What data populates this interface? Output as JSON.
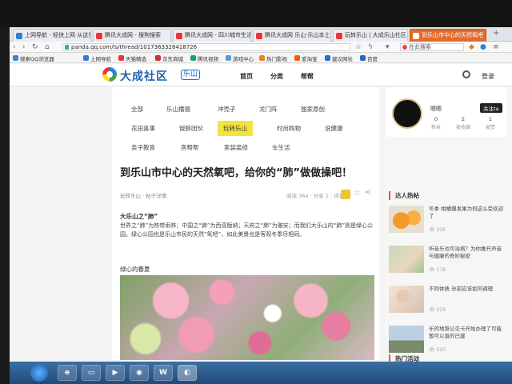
{
  "browser": {
    "tabs": [
      {
        "label": "上网导航 - 轻快上网 从这里"
      },
      {
        "label": "腾讯大成网 - 搜狗搜索"
      },
      {
        "label": "腾讯大成网 - 四川城市生活"
      },
      {
        "label": "腾讯大成网 乐山·乐山本土"
      },
      {
        "label": "玩转乐山 | 大成乐山社区"
      },
      {
        "label": "到乐山市中心的天然氧吧"
      }
    ],
    "url": "panda.qq.com/ls/thread/1017363328418726",
    "search_placeholder": "在此搜索",
    "bookmarks": [
      {
        "label": "搜索QQ浏览器",
        "color": "#3a86d6"
      },
      {
        "label": "上网导航",
        "color": "#2f7fd8"
      },
      {
        "label": "天猫精选",
        "color": "#e23b3b"
      },
      {
        "label": "京东商城",
        "color": "#d32f2f"
      },
      {
        "label": "腾讯视频",
        "color": "#1aa260"
      },
      {
        "label": "游戏中心",
        "color": "#5b9bd5"
      },
      {
        "label": "热门影视",
        "color": "#e8871e"
      },
      {
        "label": "爱淘宝",
        "color": "#f25c05"
      },
      {
        "label": "建议网址",
        "color": "#1f6fd0"
      },
      {
        "label": "百度",
        "color": "#2d63c8"
      }
    ]
  },
  "site": {
    "logo_text": "大成社区",
    "logo_badge": "乐山",
    "nav": [
      "首页",
      "分类",
      "帮帮"
    ],
    "login": "登录"
  },
  "categories": [
    {
      "label": "全部",
      "active": false
    },
    {
      "label": "乐山播报",
      "active": false
    },
    {
      "label": "冲壳子",
      "active": false
    },
    {
      "label": "龙门阵",
      "active": false
    },
    {
      "label": "独家原创",
      "active": false
    },
    {
      "label": "花田喜事",
      "active": false
    },
    {
      "label": "饭醉团伙",
      "active": false
    },
    {
      "label": "玩转乐山",
      "active": true
    },
    {
      "label": "时尚购物",
      "active": false
    },
    {
      "label": "说健康",
      "active": false
    },
    {
      "label": "亲子教育",
      "active": false
    },
    {
      "label": "房帮帮",
      "active": false
    },
    {
      "label": "家装装修",
      "active": false
    },
    {
      "label": "车生活",
      "active": false
    }
  ],
  "post": {
    "title": "到乐山市中心的天然氧吧，给你的“肺”做做操吧！",
    "meta_left": "玩转乐山 · 帖子详情",
    "meta_right": "阅读 364 · 分享 1 · 评论 1",
    "heading": "大乐山之“肺”",
    "body": "世界之“肺”为热带雨林；中国之“肺”为西双版纳；天府之“肺”为雅安；而我们大乐山的“肺”则是绿心公园。绿心公园也是乐山市民的天然“氧吧”，如此美景也是客观冬季尽相同。",
    "section_heading": "绿心的春夏"
  },
  "sidebar": {
    "username": "嗯嗯",
    "follow_label": "关注ta",
    "stats": [
      {
        "value": "0",
        "label": "粉丝"
      },
      {
        "value": "2",
        "label": "被收藏"
      },
      {
        "value": "1",
        "label": "被赞"
      }
    ],
    "hot_title": "达人热帖",
    "hot_posts": [
      {
        "text": "冬季 柑橘爆发果为何这么受欢迎了",
        "views": "328"
      },
      {
        "text": "听音乐也可治病？为你推开声音与健康的奇妙秘密",
        "views": "178"
      },
      {
        "text": "不同体质 孕前应该如何调理",
        "views": "229"
      },
      {
        "text": "乐的地铁公交卡开始办理了可能暂可以直的已建",
        "views": "520"
      }
    ],
    "activity_title": "热门活动"
  },
  "float_label": "中"
}
